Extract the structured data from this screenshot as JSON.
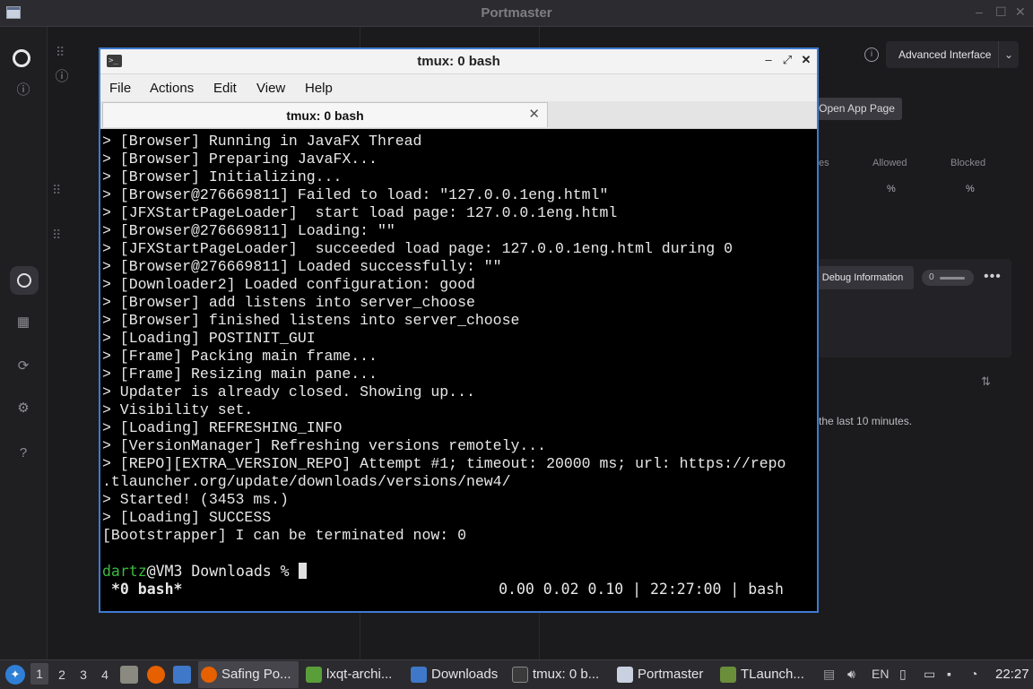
{
  "portmaster": {
    "title": "Portmaster",
    "window_controls": [
      "–",
      "☐",
      "✕"
    ],
    "advanced_interface": "Advanced Interface",
    "open_app_page": "Open App Page",
    "columns": {
      "partial": "es",
      "allowed": "Allowed",
      "blocked": "Blocked"
    },
    "values": {
      "allowed": "%",
      "blocked": "%"
    },
    "debug_information": "Debug Information",
    "debug_count": "0",
    "more_dots": "•••",
    "last_minutes_text": "the last 10 minutes."
  },
  "terminal": {
    "title": "tmux: 0 bash",
    "menu": [
      "File",
      "Actions",
      "Edit",
      "View",
      "Help"
    ],
    "tab_label": "tmux: 0 bash",
    "lines": [
      "> [Browser] Running in JavaFX Thread",
      "> [Browser] Preparing JavaFX...",
      "> [Browser] Initializing...",
      "> [Browser@276669811] Failed to load: \"127.0.0.1eng.html\"",
      "> [JFXStartPageLoader]  start load page: 127.0.0.1eng.html",
      "> [Browser@276669811] Loading: \"\"",
      "> [JFXStartPageLoader]  succeeded load page: 127.0.0.1eng.html during 0",
      "> [Browser@276669811] Loaded successfully: \"\"",
      "> [Downloader2] Loaded configuration: good",
      "> [Browser] add listens into server_choose",
      "> [Browser] finished listens into server_choose",
      "> [Loading] POSTINIT_GUI",
      "> [Frame] Packing main frame...",
      "> [Frame] Resizing main pane...",
      "> Updater is already closed. Showing up...",
      "> Visibility set.",
      "> [Loading] REFRESHING_INFO",
      "> [VersionManager] Refreshing versions remotely...",
      "> [REPO][EXTRA_VERSION_REPO] Attempt #1; timeout: 20000 ms; url: https://repo",
      ".tlauncher.org/update/downloads/versions/new4/",
      "> Started! (3453 ms.)",
      "> [Loading] SUCCESS",
      "[Bootstrapper] I can be terminated now: 0"
    ],
    "prompt_user": "dartz",
    "prompt_rest": "@VM3 Downloads % ",
    "status_left": "*0 bash*",
    "status_right": "0.00 0.02 0.10 | 22:27:00 | bash"
  },
  "taskbar": {
    "workspaces": [
      "1",
      "2",
      "3",
      "4"
    ],
    "tasks": [
      {
        "label": "Safing Po...",
        "icon": "firefox-icon",
        "color": "#e66000",
        "active": true
      },
      {
        "label": "lxqt-archi...",
        "icon": "archiver-icon",
        "color": "#5a9e3a",
        "active": false
      },
      {
        "label": "Downloads",
        "icon": "folder-icon",
        "color": "#3f78c8",
        "active": false
      },
      {
        "label": "tmux: 0 b...",
        "icon": "terminal-icon",
        "color": "#3b3b3b",
        "active": false
      },
      {
        "label": "Portmaster",
        "icon": "window-icon",
        "color": "#c9d0e0",
        "active": false
      },
      {
        "label": "TLaunch...",
        "icon": "minecraft-icon",
        "color": "#6b8e3a",
        "active": false
      }
    ],
    "keyboard_layout": "EN",
    "clock": "22:27"
  }
}
